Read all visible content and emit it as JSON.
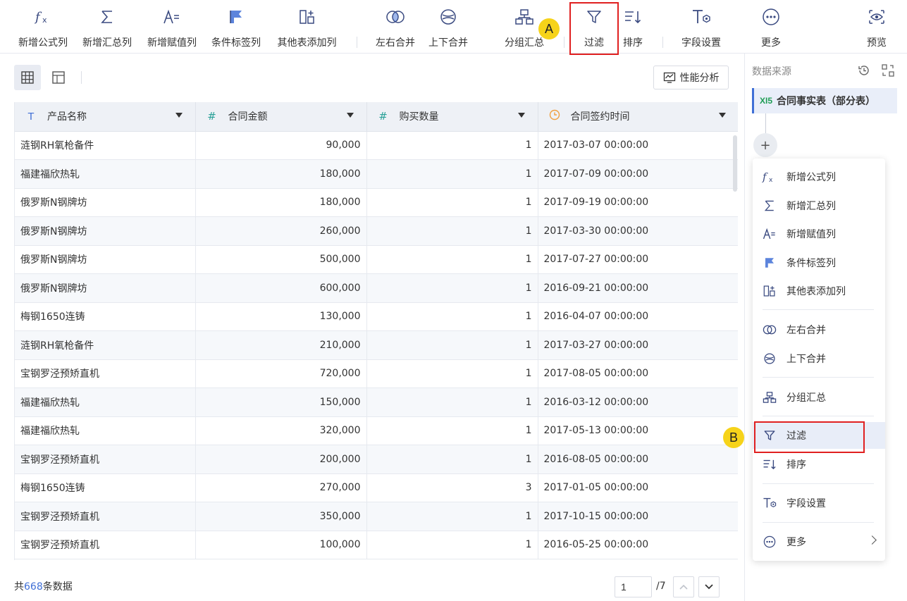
{
  "toolbar": {
    "formula": "新增公式列",
    "summary": "新增汇总列",
    "assign": "新增赋值列",
    "condition": "条件标签列",
    "other_table": "其他表添加列",
    "lr_merge": "左右合并",
    "ud_merge": "上下合并",
    "group": "分组汇总",
    "filter": "过滤",
    "sort": "排序",
    "field": "字段设置",
    "more": "更多",
    "preview": "预览"
  },
  "markers": {
    "a": "A",
    "b": "B"
  },
  "perf_label": "性能分析",
  "table": {
    "columns": [
      {
        "name": "产品名称",
        "type_icon": "T"
      },
      {
        "name": "合同金额",
        "type_icon": "#"
      },
      {
        "name": "购买数量",
        "type_icon": "#"
      },
      {
        "name": "合同签约时间",
        "type_icon": "clock"
      }
    ],
    "rows": [
      [
        "涟钢RH氧枪备件",
        "90,000",
        "1",
        "2017-03-07 00:00:00"
      ],
      [
        "福建福欣热轧",
        "180,000",
        "1",
        "2017-07-09 00:00:00"
      ],
      [
        "俄罗斯N钢牌坊",
        "180,000",
        "1",
        "2017-09-19 00:00:00"
      ],
      [
        "俄罗斯N钢牌坊",
        "260,000",
        "1",
        "2017-03-30 00:00:00"
      ],
      [
        "俄罗斯N钢牌坊",
        "500,000",
        "1",
        "2017-07-27 00:00:00"
      ],
      [
        "俄罗斯N钢牌坊",
        "600,000",
        "1",
        "2016-09-21 00:00:00"
      ],
      [
        "梅钢1650连铸",
        "130,000",
        "1",
        "2016-04-07 00:00:00"
      ],
      [
        "涟钢RH氧枪备件",
        "210,000",
        "1",
        "2017-03-27 00:00:00"
      ],
      [
        "宝钢罗泾预矫直机",
        "720,000",
        "1",
        "2017-08-05 00:00:00"
      ],
      [
        "福建福欣热轧",
        "150,000",
        "1",
        "2016-03-12 00:00:00"
      ],
      [
        "福建福欣热轧",
        "320,000",
        "1",
        "2017-05-13 00:00:00"
      ],
      [
        "宝钢罗泾预矫直机",
        "200,000",
        "1",
        "2016-08-05 00:00:00"
      ],
      [
        "梅钢1650连铸",
        "270,000",
        "3",
        "2017-01-05 00:00:00"
      ],
      [
        "宝钢罗泾预矫直机",
        "350,000",
        "1",
        "2017-10-15 00:00:00"
      ],
      [
        "宝钢罗泾预矫直机",
        "100,000",
        "1",
        "2016-05-25 00:00:00"
      ]
    ]
  },
  "footer": {
    "prefix": "共",
    "count": "668",
    "suffix": "条数据",
    "page_value": "1",
    "page_total": "/7"
  },
  "right_panel": {
    "title": "数据来源",
    "source_tag": "XI5",
    "source_name": "合同事实表（部分表）",
    "plus": "+"
  },
  "menu": {
    "formula": "新增公式列",
    "summary": "新增汇总列",
    "assign": "新增赋值列",
    "condition": "条件标签列",
    "other_table": "其他表添加列",
    "lr_merge": "左右合并",
    "ud_merge": "上下合并",
    "group": "分组汇总",
    "filter": "过滤",
    "sort": "排序",
    "field": "字段设置",
    "more": "更多"
  },
  "colors": {
    "accent": "#3f6fd6",
    "highlight_red": "#e02020",
    "marker_yellow": "#f6d31a",
    "header_bg": "#eef1f6"
  }
}
